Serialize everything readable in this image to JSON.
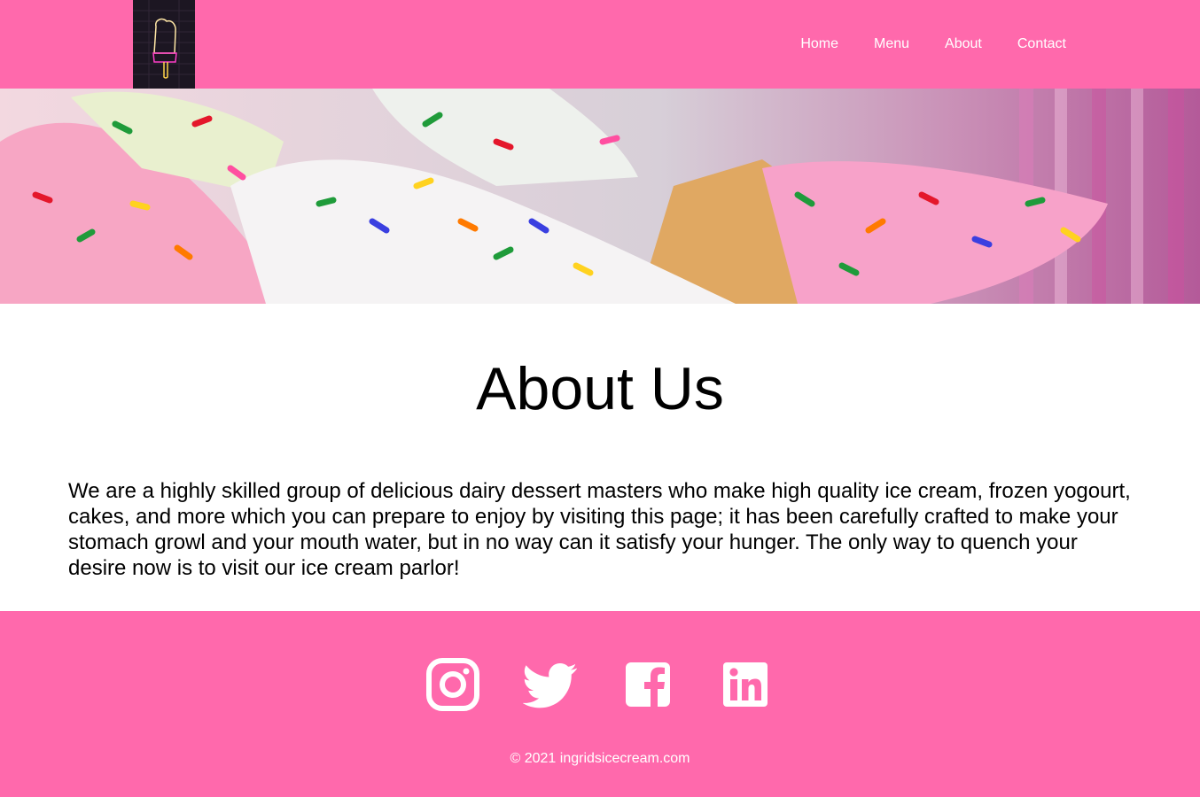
{
  "header": {
    "logo_icon": "popsicle-neon-logo-icon",
    "nav": [
      {
        "label": "Home"
      },
      {
        "label": "Menu"
      },
      {
        "label": "About"
      },
      {
        "label": "Contact"
      }
    ]
  },
  "hero": {
    "image": "ice-cream-cones-with-sprinkles"
  },
  "about": {
    "title": "About Us",
    "text": "We are a highly skilled group of delicious dairy dessert masters who make high quality ice cream, frozen yogourt, cakes, and more which you can prepare to enjoy by visiting this page; it has been carefully crafted to make your stomach growl and your mouth water, but in no way can it satisfy your hunger. The only way to quench your desire now is to visit our ice cream parlor!"
  },
  "footer": {
    "socials": [
      {
        "icon": "instagram-icon"
      },
      {
        "icon": "twitter-icon"
      },
      {
        "icon": "facebook-icon"
      },
      {
        "icon": "linkedin-icon"
      }
    ],
    "copyright": "© 2021 ingridsicecream.com"
  },
  "colors": {
    "brand_pink": "#ff69ac",
    "logo_bg": "#1c1622",
    "text": "#000000",
    "white": "#ffffff"
  }
}
